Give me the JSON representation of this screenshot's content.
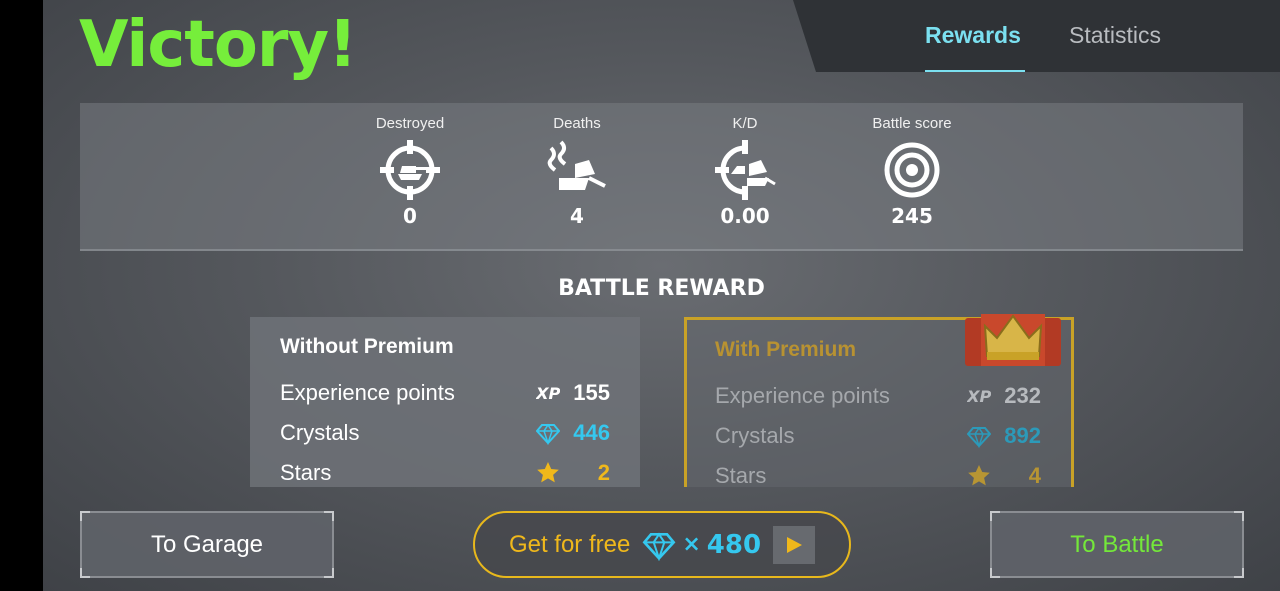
{
  "header": {
    "title": "Victory!",
    "tabs": [
      {
        "label": "Rewards",
        "active": true
      },
      {
        "label": "Statistics",
        "active": false
      }
    ]
  },
  "stats": [
    {
      "label": "Destroyed",
      "value": "0",
      "icon": "crosshair-tank-icon"
    },
    {
      "label": "Deaths",
      "value": "4",
      "icon": "burning-tank-icon"
    },
    {
      "label": "K/D",
      "value": "0.00",
      "icon": "kd-ratio-icon"
    },
    {
      "label": "Battle score",
      "value": "245",
      "icon": "target-icon"
    }
  ],
  "battle_reward": {
    "title": "BATTLE REWARD",
    "without_premium": {
      "title": "Without Premium",
      "rows": [
        {
          "label": "Experience points",
          "value": "155",
          "icon": "xp-icon"
        },
        {
          "label": "Crystals",
          "value": "446",
          "icon": "crystal-icon"
        },
        {
          "label": "Stars",
          "value": "2",
          "icon": "star-icon"
        }
      ]
    },
    "with_premium": {
      "title": "With Premium",
      "rows": [
        {
          "label": "Experience points",
          "value": "232",
          "icon": "xp-icon"
        },
        {
          "label": "Crystals",
          "value": "892",
          "icon": "crystal-icon"
        },
        {
          "label": "Stars",
          "value": "4",
          "icon": "star-icon"
        }
      ]
    }
  },
  "buttons": {
    "garage": "To Garage",
    "free": {
      "label": "Get for free",
      "times": "×",
      "amount": "480"
    },
    "battle": "To Battle"
  },
  "colors": {
    "victory": "#76ee3b",
    "tab_active": "#7be0f0",
    "crystal": "#35c8ef",
    "star": "#f0b81b",
    "premium_gold": "#c9a227"
  }
}
